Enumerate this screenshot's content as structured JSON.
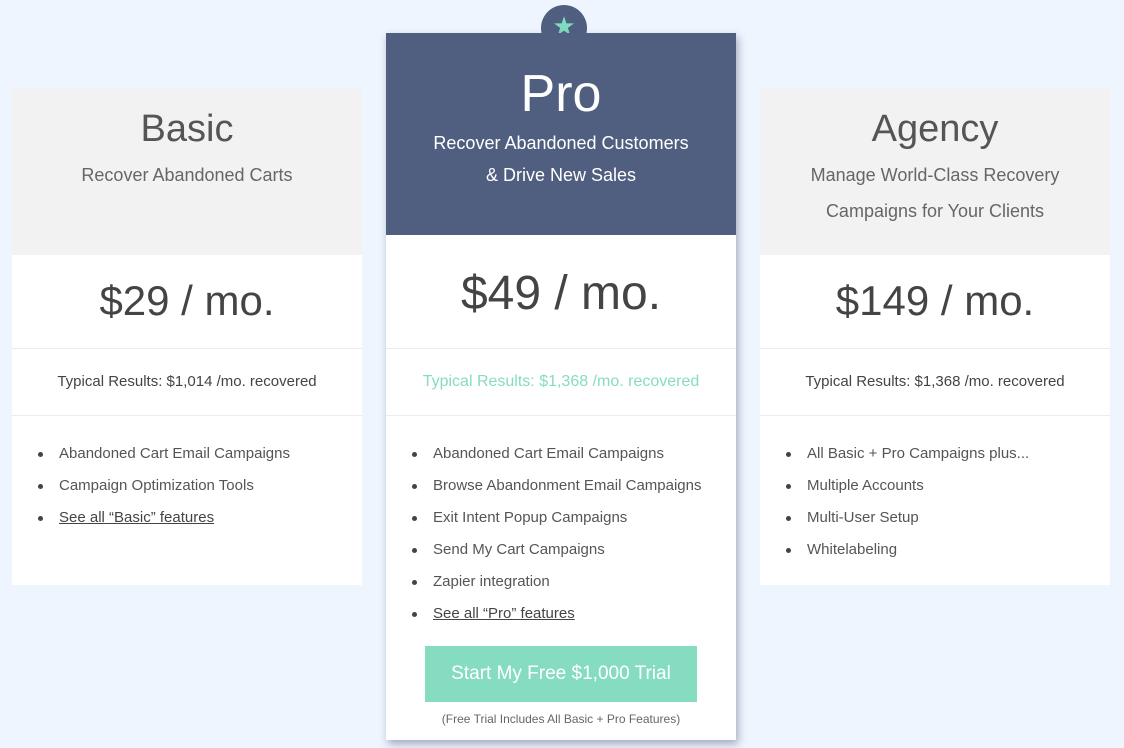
{
  "colors": {
    "page_background": "#eef5fe",
    "pro_header": "#505f80",
    "accent": "#86dcc0",
    "light_header": "#f2f2f2"
  },
  "featured_badge": {
    "icon": "star-icon",
    "glyph": "★"
  },
  "plans": [
    {
      "name": "Basic",
      "tagline": "Recover Abandoned Carts",
      "price": "$29 / mo.",
      "results": "Typical Results: $1,014 /mo. recovered",
      "features": [
        "Abandoned Cart Email Campaigns",
        "Campaign Optimization Tools"
      ],
      "features_link": "See all “Basic” features"
    },
    {
      "name": "Pro",
      "tagline_line1": "Recover Abandoned Customers",
      "tagline_line2": "& Drive New Sales",
      "price": "$49 / mo.",
      "results": "Typical Results: $1,368 /mo. recovered",
      "features": [
        "Abandoned Cart Email Campaigns",
        "Browse Abandonment Email Campaigns",
        "Exit Intent Popup Campaigns",
        "Send My Cart Campaigns",
        "Zapier integration"
      ],
      "features_link": "See all “Pro” features",
      "cta_label": "Start My Free $1,000 Trial",
      "cta_note": "(Free Trial Includes All Basic + Pro Features)"
    },
    {
      "name": "Agency",
      "tagline_line1": "Manage World-Class Recovery",
      "tagline_line2": "Campaigns for Your Clients",
      "price": "$149 / mo.",
      "results": "Typical Results: $1,368 /mo. recovered",
      "features": [
        "All Basic + Pro Campaigns plus...",
        "Multiple Accounts",
        "Multi-User Setup",
        "Whitelabeling"
      ]
    }
  ]
}
